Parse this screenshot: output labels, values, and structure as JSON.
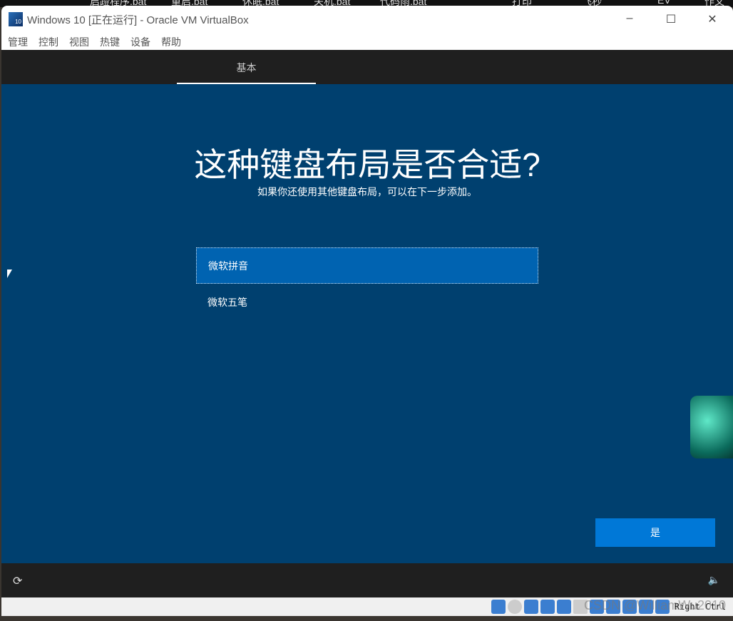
{
  "desktop": {
    "items": [
      "启蹬程序.bat",
      "重启.bat",
      "休眠.bat",
      "关机.bat",
      "代码雨.bat",
      "打印",
      "飞秒",
      "EV",
      "作文"
    ]
  },
  "window": {
    "title": "Windows 10 [正在运行] - Oracle VM VirtualBox",
    "minimize": "–",
    "maximize": "☐",
    "close": "✕"
  },
  "menu": [
    "管理",
    "控制",
    "视图",
    "热键",
    "设备",
    "帮助"
  ],
  "setup": {
    "tab": "基本",
    "heading": "这种键盘布局是否合适?",
    "subheading": "如果你还使用其他键盘布局，可以在下一步添加。",
    "options": [
      "微软拼音",
      "微软五笔"
    ],
    "yes_button": "是",
    "accessibility_icon": "⟳",
    "volume_icon": "🔈"
  },
  "status": {
    "host_key": "Right Ctrl",
    "watermark": "CSDN @WilliamWu2010"
  }
}
